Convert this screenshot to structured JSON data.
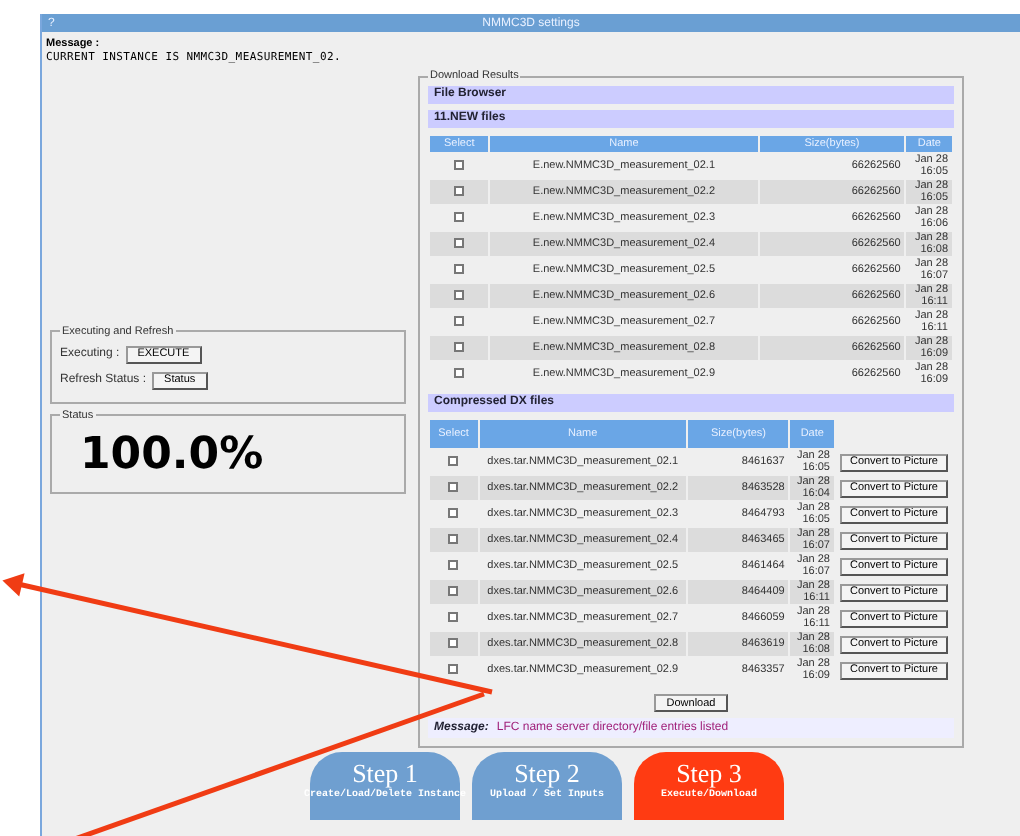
{
  "window": {
    "title": "NMMC3D settings",
    "help_icon": "?"
  },
  "message": {
    "label": "Message :",
    "text": "CURRENT INSTANCE IS NMMC3D_MEASUREMENT_02."
  },
  "exec_panel": {
    "legend": "Executing and Refresh",
    "rows": [
      {
        "label": "Executing :",
        "button": "EXECUTE"
      },
      {
        "label": "Refresh Status :",
        "button": "Status"
      }
    ]
  },
  "status_panel": {
    "legend": "Status",
    "value": "100.0%"
  },
  "download": {
    "legend": "Download Results",
    "file_browser": "File Browser",
    "new_files": {
      "title": "11.NEW files",
      "columns": [
        "Select",
        "Name",
        "Size(bytes)",
        "Date"
      ],
      "rows": [
        {
          "checked": false,
          "name": "E.new.NMMC3D_measurement_02.1",
          "size": "66262560",
          "date": "Jan 28 16:05"
        },
        {
          "checked": false,
          "name": "E.new.NMMC3D_measurement_02.2",
          "size": "66262560",
          "date": "Jan 28 16:05"
        },
        {
          "checked": false,
          "name": "E.new.NMMC3D_measurement_02.3",
          "size": "66262560",
          "date": "Jan 28 16:06"
        },
        {
          "checked": false,
          "name": "E.new.NMMC3D_measurement_02.4",
          "size": "66262560",
          "date": "Jan 28 16:08"
        },
        {
          "checked": false,
          "name": "E.new.NMMC3D_measurement_02.5",
          "size": "66262560",
          "date": "Jan 28 16:07"
        },
        {
          "checked": false,
          "name": "E.new.NMMC3D_measurement_02.6",
          "size": "66262560",
          "date": "Jan 28 16:11"
        },
        {
          "checked": false,
          "name": "E.new.NMMC3D_measurement_02.7",
          "size": "66262560",
          "date": "Jan 28 16:11"
        },
        {
          "checked": false,
          "name": "E.new.NMMC3D_measurement_02.8",
          "size": "66262560",
          "date": "Jan 28 16:09"
        },
        {
          "checked": false,
          "name": "E.new.NMMC3D_measurement_02.9",
          "size": "66262560",
          "date": "Jan 28 16:09"
        }
      ]
    },
    "compressed_files": {
      "title": "Compressed DX files",
      "columns": [
        "Select",
        "Name",
        "Size(bytes)",
        "Date"
      ],
      "rows": [
        {
          "checked": false,
          "name": "dxes.tar.NMMC3D_measurement_02.1",
          "size": "8461637",
          "date": "Jan 28 16:05",
          "button": "Convert to Picture"
        },
        {
          "checked": false,
          "name": "dxes.tar.NMMC3D_measurement_02.2",
          "size": "8463528",
          "date": "Jan 28 16:04",
          "button": "Convert to Picture"
        },
        {
          "checked": false,
          "name": "dxes.tar.NMMC3D_measurement_02.3",
          "size": "8464793",
          "date": "Jan 28 16:05",
          "button": "Convert to Picture"
        },
        {
          "checked": false,
          "name": "dxes.tar.NMMC3D_measurement_02.4",
          "size": "8463465",
          "date": "Jan 28 16:07",
          "button": "Convert to Picture"
        },
        {
          "checked": false,
          "name": "dxes.tar.NMMC3D_measurement_02.5",
          "size": "8461464",
          "date": "Jan 28 16:07",
          "button": "Convert to Picture"
        },
        {
          "checked": false,
          "name": "dxes.tar.NMMC3D_measurement_02.6",
          "size": "8464409",
          "date": "Jan 28 16:11",
          "button": "Convert to Picture"
        },
        {
          "checked": false,
          "name": "dxes.tar.NMMC3D_measurement_02.7",
          "size": "8466059",
          "date": "Jan 28 16:11",
          "button": "Convert to Picture"
        },
        {
          "checked": false,
          "name": "dxes.tar.NMMC3D_measurement_02.8",
          "size": "8463619",
          "date": "Jan 28 16:08",
          "button": "Convert to Picture"
        },
        {
          "checked": false,
          "name": "dxes.tar.NMMC3D_measurement_02.9",
          "size": "8463357",
          "date": "Jan 28 16:09",
          "button": "Convert to Picture"
        }
      ]
    },
    "download_button": "Download",
    "result_message": {
      "label": "Message:",
      "text": "LFC name server directory/file entries listed"
    }
  },
  "steps": [
    {
      "title": "Step 1",
      "subtitle": "Create/Load/Delete Instance",
      "selected": false
    },
    {
      "title": "Step 2",
      "subtitle": "Upload / Set Inputs",
      "selected": false
    },
    {
      "title": "Step 3",
      "subtitle": "Execute/Download",
      "selected": true
    }
  ],
  "annotations": [
    {
      "kind": "arrow"
    },
    {
      "kind": "line"
    }
  ]
}
